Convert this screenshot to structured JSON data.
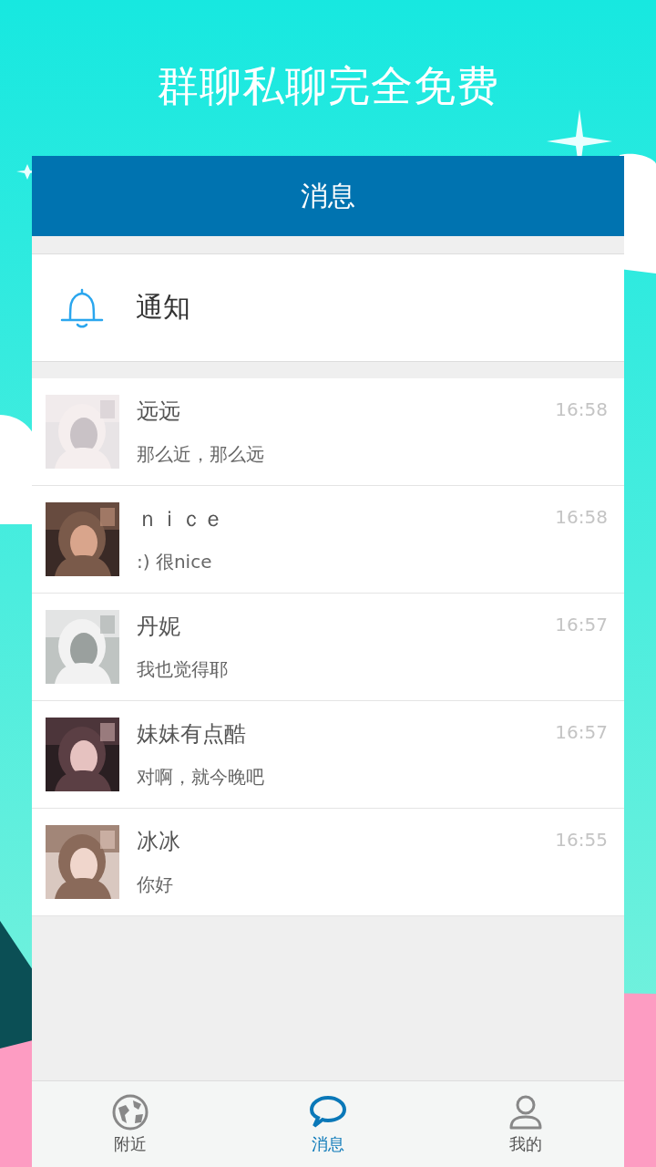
{
  "banner": {
    "title": "群聊私聊完全免费"
  },
  "header": {
    "title": "消息"
  },
  "notification": {
    "label": "通知"
  },
  "conversations": [
    {
      "name": "远远",
      "message": "那么近，那么远",
      "time": "16:58"
    },
    {
      "name": "ｎｉｃｅ",
      "message": ":)  很nice",
      "time": "16:58"
    },
    {
      "name": "丹妮",
      "message": "我也觉得耶",
      "time": "16:57"
    },
    {
      "name": "妹妹有点酷",
      "message": "对啊，就今晚吧",
      "time": "16:57"
    },
    {
      "name": "冰冰",
      "message": "你好",
      "time": "16:55"
    }
  ],
  "tabs": [
    {
      "label": "附近",
      "kind": "globe",
      "selected": false
    },
    {
      "label": "消息",
      "kind": "chat",
      "selected": true
    },
    {
      "label": "我的",
      "kind": "person",
      "selected": false
    }
  ]
}
